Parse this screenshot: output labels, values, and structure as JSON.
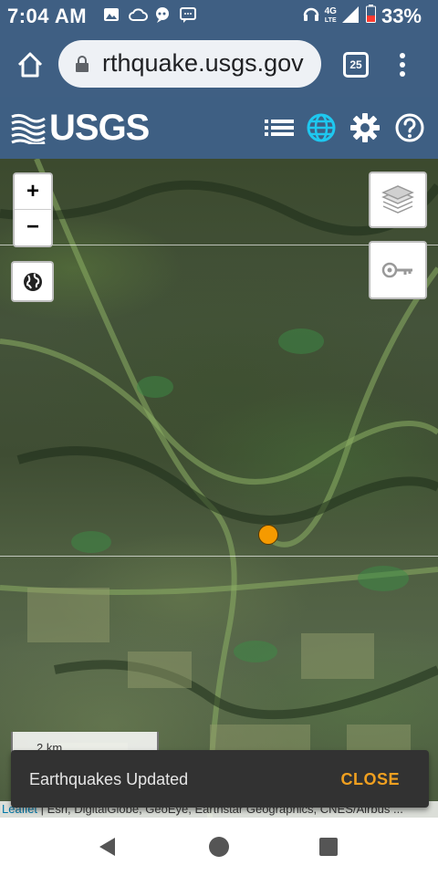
{
  "status_bar": {
    "time": "7:04 AM",
    "network": "4G",
    "network_sub": "LTE",
    "battery": "33%"
  },
  "browser": {
    "url": "rthquake.usgs.gov",
    "tab_count": "25"
  },
  "header": {
    "logo_text": "USGS"
  },
  "map": {
    "zoom_in_label": "+",
    "zoom_out_label": "−",
    "scale_label": "2 km",
    "attribution_link": "Leaflet",
    "attribution_text": " | Esri, DigitalGlobe, GeoEye, Earthstar Geographics, CNES/Airbus ..."
  },
  "snackbar": {
    "message": "Earthquakes Updated",
    "action": "CLOSE"
  },
  "colors": {
    "header_bg": "#3e5f83",
    "marker": "#f59a00",
    "snackbar_action": "#f0a020",
    "globe_active": "#1ec8f0"
  }
}
